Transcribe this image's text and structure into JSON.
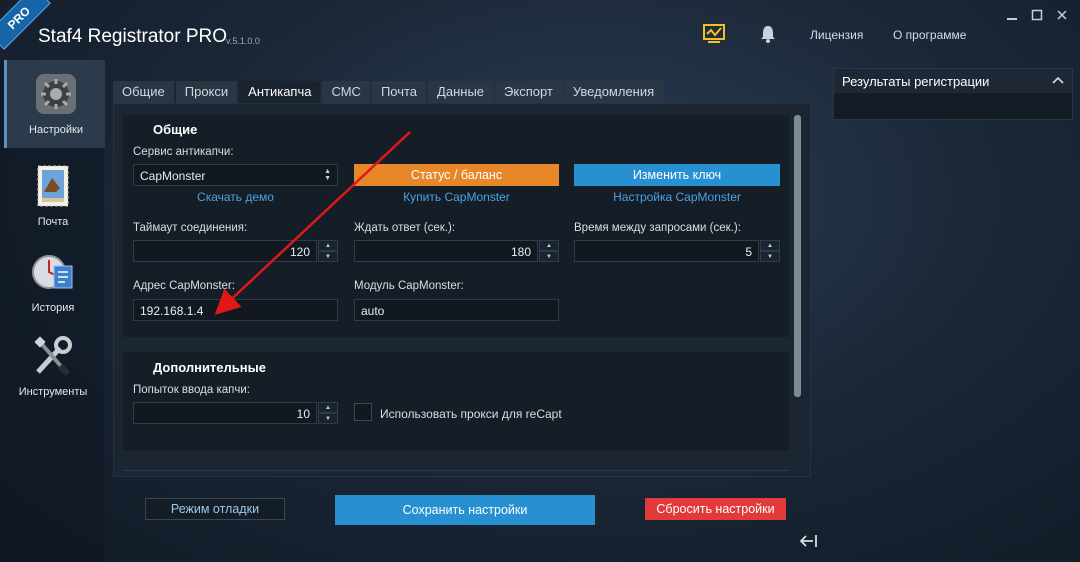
{
  "app": {
    "badge": "PRO",
    "title": "Staf4 Registrator PRO",
    "version": "v.5.1.0.0"
  },
  "topbar": {
    "license": "Лицензия",
    "about": "О программе",
    "monitor_icon": "monitor-icon",
    "bell_icon": "bell-icon"
  },
  "sidebar": {
    "items": [
      {
        "label": "Настройки",
        "icon": "settings-icon",
        "active": true
      },
      {
        "label": "Почта",
        "icon": "mail-stamp-icon",
        "active": false
      },
      {
        "label": "История",
        "icon": "history-icon",
        "active": false
      },
      {
        "label": "Инструменты",
        "icon": "tools-icon",
        "active": false
      }
    ]
  },
  "tabs": [
    "Общие",
    "Прокси",
    "Антикапча",
    "СМС",
    "Почта",
    "Данные",
    "Экспорт",
    "Уведомления"
  ],
  "active_tab": "Антикапча",
  "general": {
    "title": "Общие",
    "service_label": "Сервис антикапчи:",
    "service_value": "CapMonster",
    "download_demo": "Скачать демо",
    "status_button": "Статус / баланс",
    "buy_link": "Купить CapMonster",
    "change_key_button": "Изменить ключ",
    "setup_link": "Настройка CapMonster",
    "timeout_label": "Таймаут соединения:",
    "timeout_value": "120",
    "wait_label": "Ждать ответ (сек.):",
    "wait_value": "180",
    "interval_label": "Время между запросами (сек.):",
    "interval_value": "5",
    "address_label": "Адрес CapMonster:",
    "address_value": "192.168.1.4",
    "module_label": "Модуль CapMonster:",
    "module_value": "auto"
  },
  "extra": {
    "title": "Дополнительные",
    "attempts_label": "Попыток ввода капчи:",
    "attempts_value": "10",
    "use_proxy_label": "Использовать прокси для reCapt",
    "use_proxy_checked": false
  },
  "footer": {
    "debug_button": "Режим отладки",
    "save_button": "Сохранить настройки",
    "reset_button": "Сбросить настройки"
  },
  "results": {
    "title": "Результаты регистрации"
  },
  "colors": {
    "orange": "#e8862a",
    "blue": "#2690d0",
    "red": "#e23a3a",
    "arrow": "#e01818"
  }
}
